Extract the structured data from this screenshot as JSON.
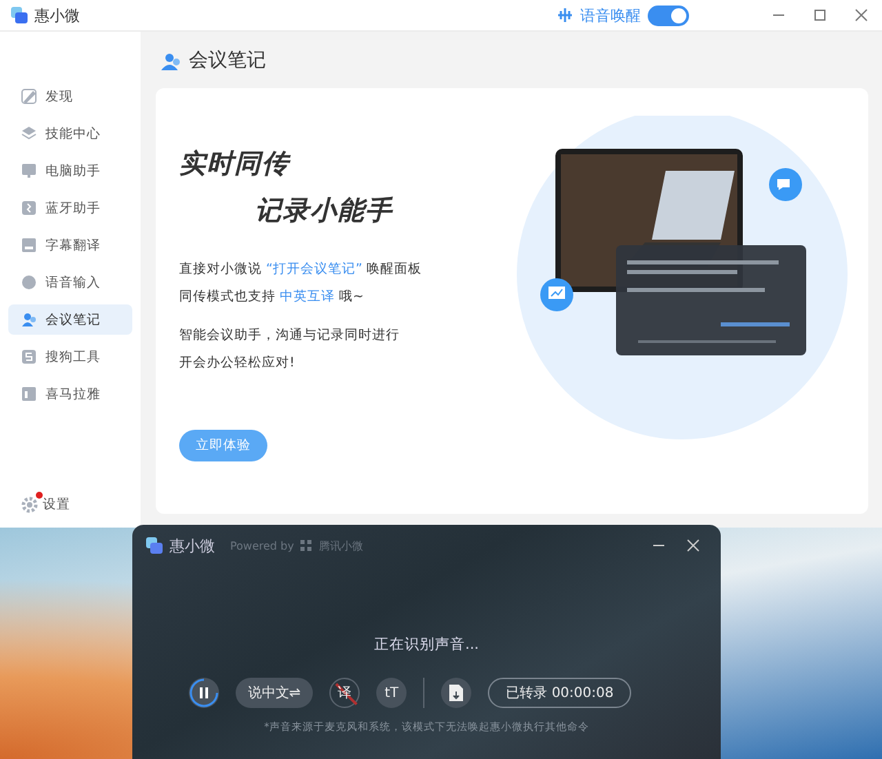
{
  "window": {
    "title": "惠小微",
    "voice_wake": {
      "label": "语音唤醒",
      "on": true
    }
  },
  "sidebar": {
    "items": [
      {
        "label": "发现",
        "selected": false
      },
      {
        "label": "技能中心",
        "selected": false
      },
      {
        "label": "电脑助手",
        "selected": false
      },
      {
        "label": "蓝牙助手",
        "selected": false
      },
      {
        "label": "字幕翻译",
        "selected": false
      },
      {
        "label": "语音输入",
        "selected": false
      },
      {
        "label": "会议笔记",
        "selected": true
      },
      {
        "label": "搜狗工具",
        "selected": false
      },
      {
        "label": "喜马拉雅",
        "selected": false
      }
    ],
    "settings": {
      "label": "设置",
      "notification": true
    }
  },
  "page": {
    "title": "会议笔记",
    "headline": [
      "实时同传",
      "记录小能手"
    ],
    "paragraphs": [
      [
        {
          "kind": "plain",
          "text": "直接对小微说 "
        },
        {
          "kind": "highlight",
          "text": "“打开会议笔记”"
        },
        {
          "kind": "plain",
          "text": " 唤醒面板"
        }
      ],
      [
        {
          "kind": "plain",
          "text": "同传模式也支持 "
        },
        {
          "kind": "highlight",
          "text": "中英互译"
        },
        {
          "kind": "plain",
          "text": " 哦~"
        }
      ],
      [
        {
          "kind": "plain",
          "text": "智能会议助手，沟通与记录同时进行"
        }
      ],
      [
        {
          "kind": "plain",
          "text": "开会办公轻松应对!"
        }
      ]
    ],
    "button": "立即体验"
  },
  "panel": {
    "title": "惠小微",
    "powered_by": "Powered by",
    "brand": "腾讯小微",
    "status": "正在识别声音...",
    "language_button": "说中文⇌",
    "translate": {
      "label": "译",
      "enabled": false
    },
    "font_button": "tT",
    "transcribed": "已转录 00:00:08",
    "note": "*声音来源于麦克风和系统，该模式下无法唤起惠小微执行其他命令"
  }
}
